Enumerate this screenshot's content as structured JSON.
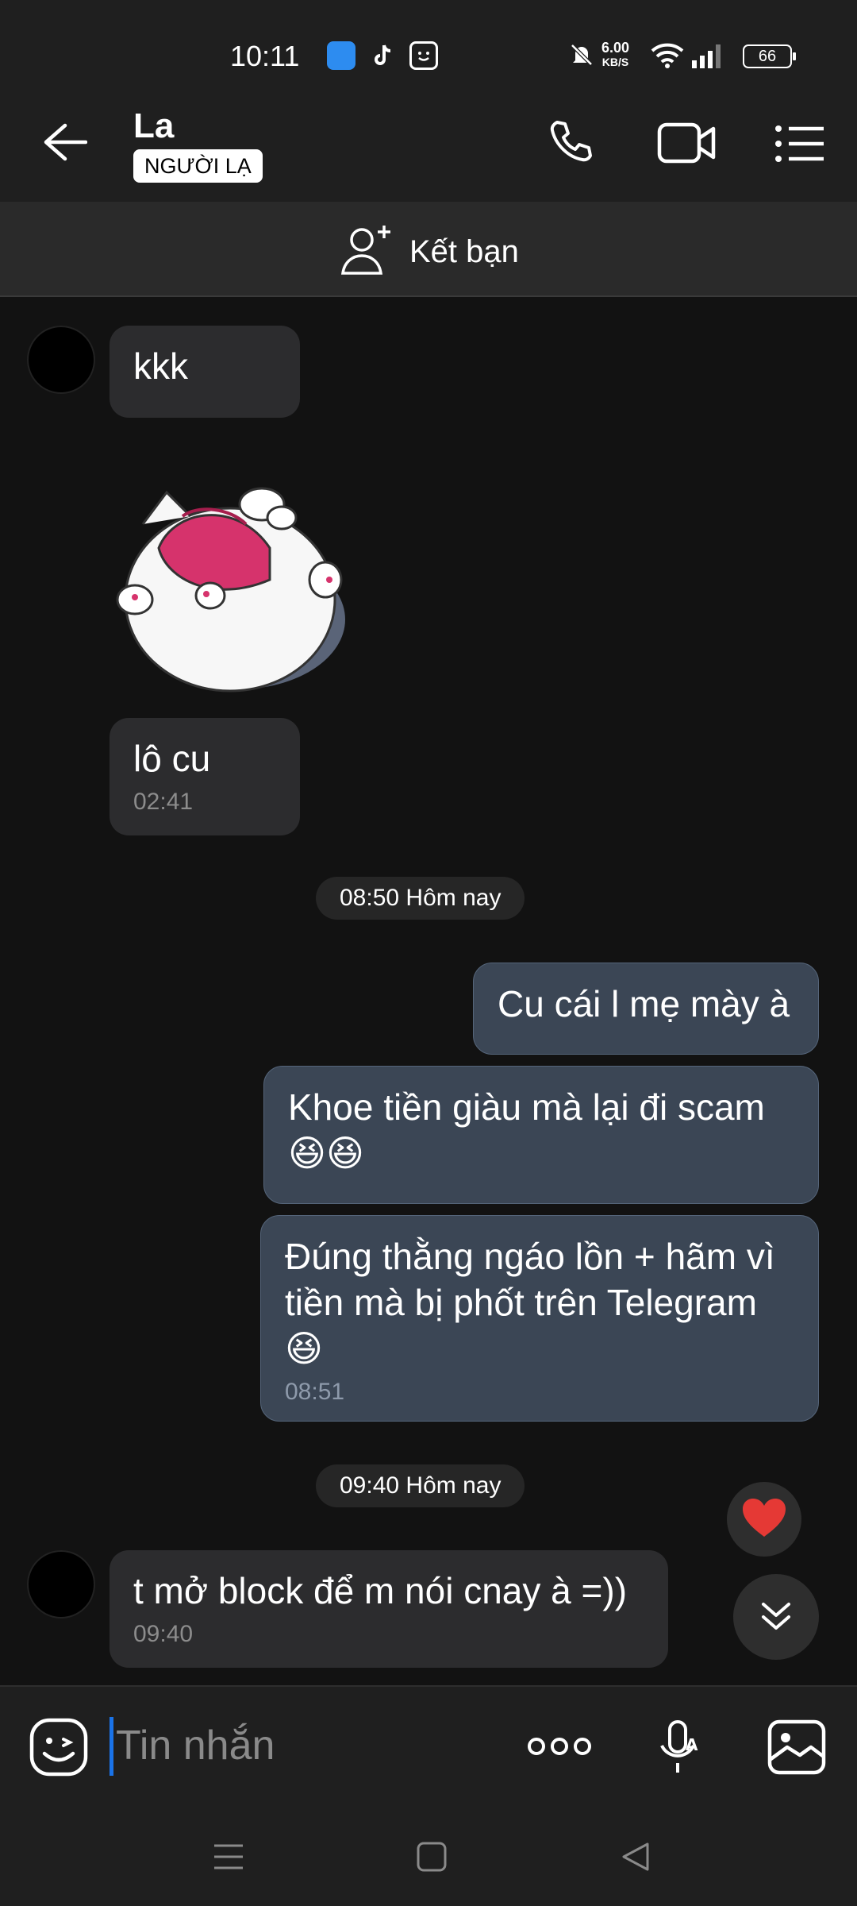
{
  "status_bar": {
    "time": "10:11",
    "net_speed": "6.00",
    "net_unit": "KB/S",
    "battery": "66"
  },
  "header": {
    "contact_name": "La",
    "badge": "NGƯỜI LẠ",
    "add_friend_label": "Kết bạn"
  },
  "messages": [
    {
      "dir": "in",
      "text": "kkk"
    },
    {
      "dir": "in",
      "type": "sticker"
    },
    {
      "dir": "in",
      "text": "lô cu",
      "time": "02:41"
    },
    {
      "type": "date",
      "text": "08:50 Hôm nay"
    },
    {
      "dir": "out",
      "text": "Cu cái l mẹ mày à"
    },
    {
      "dir": "out",
      "text": "Khoe tiền giàu mà lại đi scam 😆😆"
    },
    {
      "dir": "out",
      "text": "Đúng thằng ngáo lồn + hãm vì tiền mà bị phốt trên Telegram 😆",
      "time": "08:51"
    },
    {
      "type": "date",
      "text": "09:40 Hôm nay"
    },
    {
      "dir": "in",
      "text": "t mở block để m nói cnay à =))",
      "time": "09:40"
    }
  ],
  "composer": {
    "placeholder": "Tin nhắn"
  },
  "icons": {
    "back": "arrow-left-icon",
    "call": "phone-icon",
    "video": "video-camera-icon",
    "menu": "list-menu-icon",
    "add_friend": "person-add-icon",
    "emoji": "emoji-icon",
    "more": "more-dots-icon",
    "voice": "mic-icon",
    "image": "image-icon",
    "heart": "heart-icon",
    "scroll_down": "chevron-double-down-icon"
  },
  "colors": {
    "outgoing_bubble": "#3b4655",
    "incoming_bubble": "#2c2c2e",
    "accent": "#1a73e8",
    "heart": "#e53935"
  }
}
